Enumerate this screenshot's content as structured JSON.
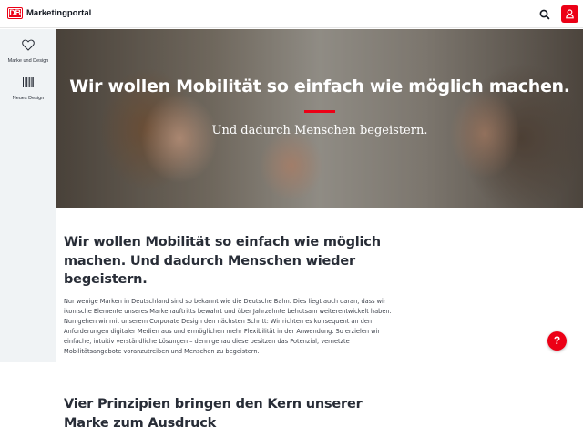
{
  "header": {
    "logo_text": "DB",
    "brand": "Marketingportal",
    "search_icon": "search-icon",
    "user_icon": "user-icon",
    "accent": "#ec0016"
  },
  "sidebar": {
    "items": [
      {
        "label": "Marke und Design",
        "icon": "heart-icon"
      },
      {
        "label": "Neues Design",
        "icon": "barcode-icon"
      }
    ]
  },
  "hero": {
    "title": "Wir wollen Mobilität so einfach wie möglich machen.",
    "subtitle": "Und dadurch Menschen begeistern."
  },
  "intro": {
    "heading": "Wir wollen Mobilität so einfach wie möglich machen. Und dadurch Menschen wieder begeistern.",
    "body": "Nur wenige Marken in Deutschland sind so bekannt wie die Deutsche Bahn. Dies liegt auch daran, dass wir ikonische Elemente unseres Markenauftritts bewahrt und über Jahrzehnte behutsam weiterentwickelt haben. Nun gehen wir mit unserem Corporate Design den nächsten Schritt: Wir richten es konsequent an den Anforderungen digitaler Medien aus und ermöglichen mehr Flexibilität in der Anwendung. So erzielen wir einfache, intuitiv verständliche Lösungen – denn genau diese besitzen das Potenzial, vernetzte Mobilitätsangebote voranzutreiben und Menschen zu begeistern."
  },
  "principles": {
    "heading": "Vier Prinzipien bringen den Kern unserer Marke zum Ausdruck"
  },
  "help": {
    "label": "?"
  }
}
